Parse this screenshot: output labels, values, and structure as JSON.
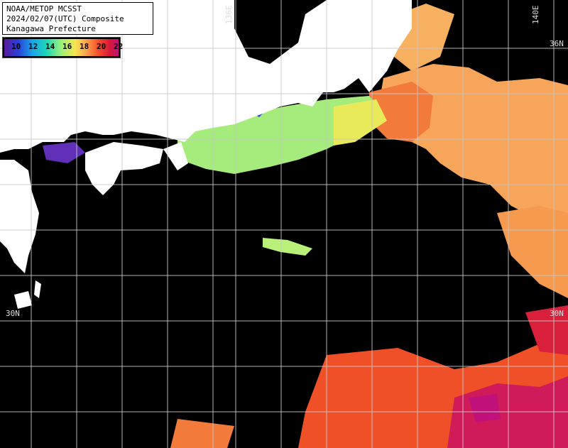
{
  "title": {
    "line1": "NOAA/METOP MCSST",
    "line2": "2024/02/07(UTC) Composite",
    "line3": "Kanagawa Prefecture"
  },
  "scale": {
    "labels": [
      "10",
      "12",
      "14",
      "16",
      "18",
      "20",
      "22"
    ],
    "colors": [
      "#5a1a9a",
      "#2a3fd8",
      "#1aa7e6",
      "#1fd6b8",
      "#9cf07a",
      "#f6e650",
      "#fda050",
      "#f4502a",
      "#d81a3a",
      "#c0107a"
    ]
  },
  "grid_labels": {
    "lon_136": "136E",
    "lon_140": "140E",
    "lat_36": "36N",
    "lat_30_left": "30N",
    "lat_30_right": "30N"
  },
  "colors": {
    "land": "#ffffff",
    "no_data": "#000000",
    "grid": "#bfbfbf"
  }
}
